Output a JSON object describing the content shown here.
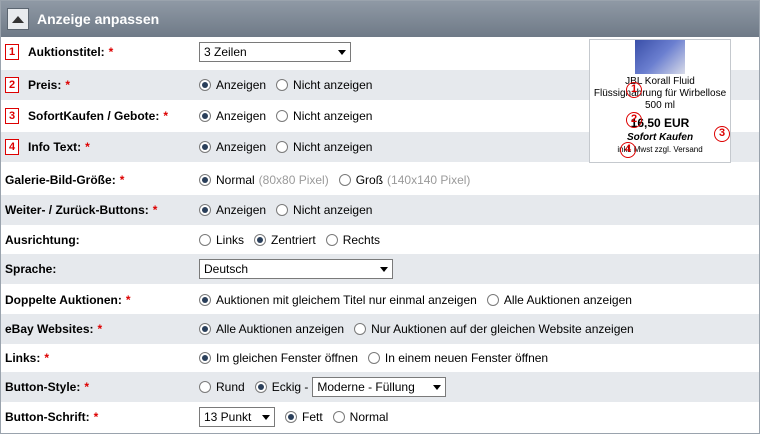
{
  "header": {
    "title": "Anzeige anpassen"
  },
  "rows": {
    "auktionstitel": {
      "num": "1",
      "label": "Auktionstitel:",
      "select": "3 Zeilen"
    },
    "preis": {
      "num": "2",
      "label": "Preis:",
      "opt1": "Anzeigen",
      "opt2": "Nicht anzeigen"
    },
    "sofortkaufen": {
      "num": "3",
      "label": "SofortKaufen / Gebote:",
      "opt1": "Anzeigen",
      "opt2": "Nicht anzeigen"
    },
    "infotext": {
      "num": "4",
      "label": "Info Text:",
      "opt1": "Anzeigen",
      "opt2": "Nicht anzeigen"
    },
    "galerie": {
      "label": "Galerie-Bild-Größe:",
      "opt1": "Normal",
      "hint1": "(80x80 Pixel)",
      "opt2": "Groß",
      "hint2": "(140x140 Pixel)"
    },
    "weiter": {
      "label": "Weiter- / Zurück-Buttons:",
      "opt1": "Anzeigen",
      "opt2": "Nicht anzeigen"
    },
    "ausrichtung": {
      "label": "Ausrichtung:",
      "opt1": "Links",
      "opt2": "Zentriert",
      "opt3": "Rechts"
    },
    "sprache": {
      "label": "Sprache:",
      "select": "Deutsch"
    },
    "doppelte": {
      "label": "Doppelte Auktionen:",
      "opt1": "Auktionen mit gleichem Titel nur einmal anzeigen",
      "opt2": "Alle Auktionen anzeigen"
    },
    "websites": {
      "label": "eBay Websites:",
      "opt1": "Alle Auktionen anzeigen",
      "opt2": "Nur Auktionen auf der gleichen Website anzeigen"
    },
    "links": {
      "label": "Links:",
      "opt1": "Im gleichen Fenster öffnen",
      "opt2": "In einem neuen Fenster öffnen"
    },
    "buttonstyle": {
      "label": "Button-Style:",
      "opt1": "Rund",
      "opt2": "Eckig -",
      "select": "Moderne - Füllung"
    },
    "buttonschrift": {
      "label": "Button-Schrift:",
      "select": "13 Punkt",
      "opt1": "Fett",
      "opt2": "Normal"
    }
  },
  "required_mark": "*",
  "preview": {
    "title": "JBL Korall Fluid Flüssignahrung für Wirbellose 500 ml",
    "price": "16,50 EUR",
    "buy": "Sofort Kaufen",
    "shipping": "inkl. Mwst zzgl. Versand",
    "markers": [
      "1",
      "2",
      "3",
      "4"
    ]
  }
}
